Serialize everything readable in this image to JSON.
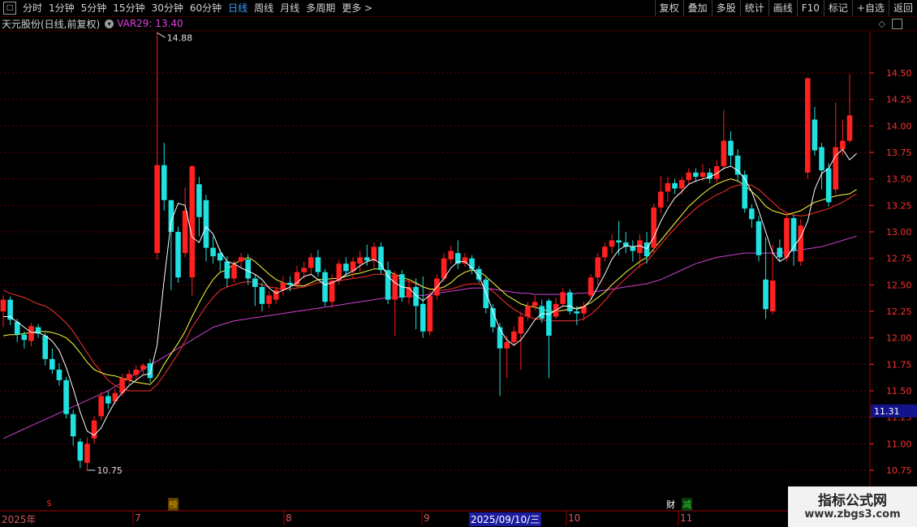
{
  "toolbar": {
    "periods": [
      "分时",
      "1分钟",
      "5分钟",
      "15分钟",
      "30分钟",
      "60分钟",
      "日线",
      "周线",
      "月线",
      "多周期",
      "更多 >"
    ],
    "active_period": "日线",
    "right_buttons": [
      "复权",
      "叠加",
      "多股",
      "统计",
      "画线",
      "F10",
      "标记",
      "+自选",
      "返回"
    ]
  },
  "title": {
    "stock": "天元股份(日线,前复权)",
    "indicator": "VAR29: 13.40"
  },
  "price_axis": {
    "ticks": [
      "14.50",
      "14.25",
      "14.00",
      "13.75",
      "13.50",
      "13.25",
      "13.00",
      "12.75",
      "12.50",
      "12.25",
      "12.00",
      "11.75",
      "11.50",
      "11.25",
      "11.00",
      "10.75"
    ],
    "current_price": "11.31"
  },
  "annotations": {
    "high": "14.88",
    "low": "10.75"
  },
  "date_axis": [
    {
      "label": "2025年",
      "selected": false
    },
    {
      "label": "7",
      "selected": false
    },
    {
      "label": "8",
      "selected": false
    },
    {
      "label": "9",
      "selected": false
    },
    {
      "label": "2025/09/10/三",
      "selected": true
    },
    {
      "label": "10",
      "selected": false
    },
    {
      "label": "11",
      "selected": false
    }
  ],
  "event_marks": [
    {
      "text": "$",
      "color": "#e02020"
    },
    {
      "text": "榜",
      "color": "#e0a000"
    },
    {
      "text": "财",
      "color": "#ffffff"
    },
    {
      "text": "减",
      "color": "#30d030"
    }
  ],
  "watermark": {
    "title": "指标公式网",
    "url": "www.zbgs3.com"
  },
  "colors": {
    "up": "#ff2020",
    "down": "#20e0e0",
    "ma_white": "#ffffff",
    "ma_yellow": "#ffff40",
    "ma_red": "#ff3030",
    "ma_magenta": "#d040d0",
    "grid": "#6a0000",
    "axis_text": "#ff3030"
  },
  "chart_data": {
    "type": "candlestick",
    "ylim": [
      10.6,
      14.95
    ],
    "candles": [
      [
        12.25,
        12.36,
        12.4,
        12.1
      ],
      [
        12.36,
        12.17,
        12.39,
        12.12
      ],
      [
        12.15,
        12.03,
        12.18,
        11.96
      ],
      [
        12.03,
        11.98,
        12.06,
        11.9
      ],
      [
        11.97,
        12.11,
        12.14,
        11.92
      ],
      [
        12.1,
        12.04,
        12.13,
        12.0
      ],
      [
        12.02,
        11.8,
        12.05,
        11.74
      ],
      [
        11.8,
        11.7,
        11.9,
        11.66
      ],
      [
        11.7,
        11.6,
        11.76,
        11.55
      ],
      [
        11.6,
        11.28,
        11.63,
        11.24
      ],
      [
        11.28,
        11.07,
        11.32,
        10.98
      ],
      [
        11.02,
        10.84,
        11.05,
        10.77
      ],
      [
        10.82,
        11.0,
        11.06,
        10.75
      ],
      [
        11.05,
        11.22,
        11.26,
        11.0
      ],
      [
        11.26,
        11.45,
        11.49,
        11.22
      ],
      [
        11.45,
        11.38,
        11.5,
        11.33
      ],
      [
        11.4,
        11.48,
        11.52,
        11.37
      ],
      [
        11.48,
        11.62,
        11.66,
        11.45
      ],
      [
        11.6,
        11.66,
        11.7,
        11.55
      ],
      [
        11.65,
        11.7,
        11.74,
        11.6
      ],
      [
        11.7,
        11.74,
        11.76,
        11.66
      ],
      [
        11.76,
        11.62,
        11.8,
        11.58
      ],
      [
        12.8,
        13.63,
        14.88,
        12.74
      ],
      [
        13.63,
        13.3,
        13.84,
        13.2
      ],
      [
        13.3,
        13.0,
        13.05,
        12.45
      ],
      [
        13.0,
        12.57,
        13.05,
        12.52
      ],
      [
        12.8,
        13.2,
        13.42,
        12.76
      ],
      [
        12.57,
        13.62,
        13.63,
        12.4
      ],
      [
        13.45,
        13.14,
        13.52,
        12.96
      ],
      [
        13.3,
        12.85,
        13.35,
        12.72
      ],
      [
        12.85,
        12.77,
        12.96,
        12.7
      ],
      [
        12.8,
        12.73,
        12.84,
        12.63
      ],
      [
        12.72,
        12.56,
        12.77,
        12.48
      ],
      [
        12.56,
        12.69,
        12.73,
        12.52
      ],
      [
        12.72,
        12.76,
        12.8,
        12.66
      ],
      [
        12.74,
        12.56,
        12.79,
        12.5
      ],
      [
        12.56,
        12.48,
        12.6,
        12.3
      ],
      [
        12.48,
        12.32,
        12.52,
        12.25
      ],
      [
        12.32,
        12.4,
        12.44,
        12.28
      ],
      [
        12.36,
        12.45,
        12.48,
        12.32
      ],
      [
        12.45,
        12.52,
        12.58,
        12.4
      ],
      [
        12.52,
        12.5,
        12.58,
        12.44
      ],
      [
        12.5,
        12.62,
        12.68,
        12.47
      ],
      [
        12.62,
        12.66,
        12.72,
        12.56
      ],
      [
        12.66,
        12.76,
        12.8,
        12.6
      ],
      [
        12.76,
        12.62,
        12.83,
        12.58
      ],
      [
        12.62,
        12.34,
        12.65,
        12.3
      ],
      [
        12.34,
        12.54,
        12.6,
        12.28
      ],
      [
        12.54,
        12.7,
        12.74,
        12.5
      ],
      [
        12.7,
        12.63,
        12.76,
        12.58
      ],
      [
        12.63,
        12.72,
        12.76,
        12.56
      ],
      [
        12.7,
        12.76,
        12.82,
        12.62
      ],
      [
        12.76,
        12.73,
        12.88,
        12.68
      ],
      [
        12.73,
        12.86,
        12.9,
        12.66
      ],
      [
        12.86,
        12.64,
        12.9,
        12.6
      ],
      [
        12.64,
        12.36,
        12.72,
        12.32
      ],
      [
        12.36,
        12.6,
        12.63,
        12.02
      ],
      [
        12.6,
        12.38,
        12.64,
        12.34
      ],
      [
        12.38,
        12.48,
        12.55,
        12.32
      ],
      [
        12.48,
        12.3,
        12.56,
        12.08
      ],
      [
        12.32,
        12.06,
        12.58,
        12.0
      ],
      [
        12.06,
        12.4,
        12.44,
        12.02
      ],
      [
        12.4,
        12.56,
        12.6,
        12.36
      ],
      [
        12.56,
        12.75,
        12.8,
        12.53
      ],
      [
        12.74,
        12.82,
        12.87,
        12.7
      ],
      [
        12.8,
        12.7,
        12.92,
        12.65
      ],
      [
        12.7,
        12.76,
        12.8,
        12.67
      ],
      [
        12.75,
        12.65,
        12.78,
        12.6
      ],
      [
        12.65,
        12.55,
        12.68,
        12.52
      ],
      [
        12.55,
        12.28,
        12.57,
        12.23
      ],
      [
        12.28,
        12.1,
        12.32,
        12.05
      ],
      [
        12.1,
        11.9,
        12.14,
        11.45
      ],
      [
        11.9,
        11.96,
        12.02,
        11.62
      ],
      [
        11.96,
        12.06,
        12.11,
        11.92
      ],
      [
        12.04,
        12.2,
        12.24,
        11.7
      ],
      [
        12.2,
        12.3,
        12.34,
        12.16
      ],
      [
        12.3,
        12.34,
        12.4,
        12.26
      ],
      [
        12.3,
        12.18,
        12.36,
        12.14
      ],
      [
        12.35,
        12.02,
        12.37,
        11.62
      ],
      [
        12.2,
        12.32,
        12.38,
        12.18
      ],
      [
        12.32,
        12.43,
        12.47,
        12.29
      ],
      [
        12.43,
        12.25,
        12.46,
        12.22
      ],
      [
        12.25,
        12.23,
        12.3,
        12.12
      ],
      [
        12.23,
        12.3,
        12.34,
        12.16
      ],
      [
        12.4,
        12.57,
        12.6,
        12.36
      ],
      [
        12.57,
        12.76,
        12.8,
        12.5
      ],
      [
        12.76,
        12.86,
        12.9,
        12.72
      ],
      [
        12.86,
        12.92,
        12.98,
        12.8
      ],
      [
        12.92,
        12.9,
        13.1,
        12.78
      ],
      [
        12.9,
        12.86,
        13.0,
        12.8
      ],
      [
        12.86,
        12.82,
        12.92,
        12.72
      ],
      [
        12.8,
        12.92,
        12.98,
        12.66
      ],
      [
        12.9,
        12.77,
        13.0,
        12.7
      ],
      [
        12.85,
        13.23,
        13.27,
        12.8
      ],
      [
        13.23,
        13.38,
        13.53,
        13.18
      ],
      [
        13.38,
        13.46,
        13.52,
        13.28
      ],
      [
        13.46,
        13.41,
        13.5,
        13.36
      ],
      [
        13.41,
        13.49,
        13.52,
        13.35
      ],
      [
        13.49,
        13.56,
        13.6,
        13.44
      ],
      [
        13.56,
        13.52,
        13.6,
        13.47
      ],
      [
        13.52,
        13.56,
        13.64,
        13.48
      ],
      [
        13.56,
        13.5,
        13.6,
        13.46
      ],
      [
        13.5,
        13.62,
        13.68,
        13.46
      ],
      [
        13.62,
        13.86,
        14.15,
        13.58
      ],
      [
        13.86,
        13.72,
        13.95,
        13.62
      ],
      [
        13.72,
        13.54,
        13.78,
        13.48
      ],
      [
        13.54,
        13.22,
        13.58,
        13.18
      ],
      [
        13.22,
        13.12,
        13.26,
        13.04
      ],
      [
        13.1,
        12.78,
        13.15,
        12.72
      ],
      [
        12.55,
        12.27,
        12.95,
        12.18
      ],
      [
        12.25,
        12.54,
        12.88,
        12.22
      ],
      [
        12.85,
        12.76,
        12.93,
        12.72
      ],
      [
        12.76,
        13.13,
        13.18,
        12.72
      ],
      [
        13.13,
        12.82,
        13.16,
        12.68
      ],
      [
        12.72,
        13.06,
        13.12,
        12.68
      ],
      [
        13.56,
        14.45,
        14.46,
        13.5
      ],
      [
        14.06,
        13.77,
        14.18,
        13.72
      ],
      [
        13.8,
        13.58,
        13.84,
        13.4
      ],
      [
        13.6,
        13.28,
        13.65,
        13.24
      ],
      [
        13.4,
        13.8,
        14.22,
        13.36
      ],
      [
        13.78,
        13.86,
        14.06,
        13.72
      ],
      [
        13.86,
        14.1,
        14.49,
        13.84
      ]
    ],
    "ma_white": [
      12.2,
      12.2,
      12.15,
      12.1,
      12.05,
      12.05,
      12.02,
      11.97,
      11.88,
      11.72,
      11.52,
      11.3,
      11.12,
      11.08,
      11.15,
      11.28,
      11.4,
      11.48,
      11.55,
      11.6,
      11.65,
      11.66,
      11.93,
      12.55,
      13.1,
      13.27,
      13.25,
      12.95,
      12.9,
      13.05,
      12.98,
      12.82,
      12.72,
      12.7,
      12.66,
      12.63,
      12.6,
      12.55,
      12.47,
      12.42,
      12.45,
      12.48,
      12.52,
      12.58,
      12.6,
      12.55,
      12.5,
      12.52,
      12.55,
      12.6,
      12.63,
      12.68,
      12.72,
      12.74,
      12.7,
      12.58,
      12.52,
      12.48,
      12.47,
      12.4,
      12.35,
      12.4,
      12.48,
      12.56,
      12.66,
      12.72,
      12.72,
      12.66,
      12.58,
      12.43,
      12.25,
      12.08,
      11.98,
      11.93,
      11.98,
      12.07,
      12.17,
      12.23,
      12.22,
      12.26,
      12.3,
      12.3,
      12.27,
      12.29,
      12.36,
      12.48,
      12.6,
      12.74,
      12.83,
      12.87,
      12.86,
      12.87,
      12.84,
      12.95,
      13.1,
      13.22,
      13.32,
      13.38,
      13.45,
      13.48,
      13.5,
      13.52,
      13.55,
      13.6,
      13.62,
      13.58,
      13.5,
      13.38,
      13.2,
      13.0,
      12.8,
      12.72,
      12.76,
      12.86,
      12.95,
      13.1,
      13.4,
      13.55,
      13.6,
      13.72,
      13.78,
      13.68,
      13.74
    ],
    "ma_yellow": [
      12.02,
      12.03,
      12.03,
      12.04,
      12.05,
      12.06,
      12.06,
      12.05,
      12.03,
      12.0,
      11.94,
      11.86,
      11.77,
      11.7,
      11.67,
      11.65,
      11.64,
      11.62,
      11.6,
      11.58,
      11.57,
      11.56,
      11.63,
      11.75,
      11.85,
      11.95,
      12.06,
      12.2,
      12.33,
      12.45,
      12.55,
      12.62,
      12.64,
      12.7,
      12.73,
      12.76,
      12.72,
      12.66,
      12.6,
      12.55,
      12.52,
      12.5,
      12.49,
      12.49,
      12.52,
      12.55,
      12.55,
      12.56,
      12.56,
      12.58,
      12.6,
      12.61,
      12.63,
      12.65,
      12.65,
      12.63,
      12.6,
      12.57,
      12.55,
      12.52,
      12.48,
      12.46,
      12.46,
      12.48,
      12.52,
      12.58,
      12.62,
      12.64,
      12.63,
      12.58,
      12.52,
      12.46,
      12.4,
      12.36,
      12.32,
      12.3,
      12.29,
      12.27,
      12.25,
      12.25,
      12.26,
      12.27,
      12.28,
      12.3,
      12.33,
      12.38,
      12.43,
      12.5,
      12.56,
      12.62,
      12.67,
      12.72,
      12.76,
      12.84,
      12.92,
      13.0,
      13.08,
      13.16,
      13.24,
      13.3,
      13.36,
      13.41,
      13.45,
      13.48,
      13.5,
      13.48,
      13.44,
      13.38,
      13.32,
      13.24,
      13.2,
      13.18,
      13.16,
      13.18,
      13.2,
      13.24,
      13.28,
      13.3,
      13.32,
      13.34,
      13.35,
      13.36,
      13.4
    ],
    "ma_red": [
      12.45,
      12.42,
      12.4,
      12.38,
      12.35,
      12.32,
      12.3,
      12.26,
      12.2,
      12.14,
      12.06,
      11.96,
      11.86,
      11.76,
      11.68,
      11.6,
      11.55,
      11.52,
      11.5,
      11.5,
      11.5,
      11.5,
      11.56,
      11.65,
      11.75,
      11.85,
      11.97,
      12.1,
      12.2,
      12.3,
      12.38,
      12.45,
      12.48,
      12.5,
      12.52,
      12.53,
      12.52,
      12.5,
      12.48,
      12.47,
      12.46,
      12.46,
      12.47,
      12.48,
      12.5,
      12.52,
      12.52,
      12.53,
      12.54,
      12.55,
      12.56,
      12.57,
      12.58,
      12.6,
      12.6,
      12.59,
      12.57,
      12.55,
      12.53,
      12.51,
      12.48,
      12.46,
      12.45,
      12.45,
      12.46,
      12.48,
      12.5,
      12.51,
      12.51,
      12.48,
      12.44,
      12.38,
      12.32,
      12.27,
      12.23,
      12.2,
      12.18,
      12.17,
      12.16,
      12.16,
      12.16,
      12.16,
      12.16,
      12.18,
      12.22,
      12.28,
      12.35,
      12.43,
      12.5,
      12.56,
      12.62,
      12.68,
      12.72,
      12.8,
      12.88,
      12.96,
      13.03,
      13.1,
      13.16,
      13.22,
      13.27,
      13.31,
      13.35,
      13.38,
      13.42,
      13.44,
      13.45,
      13.44,
      13.4,
      13.34,
      13.28,
      13.22,
      13.18,
      13.16,
      13.15,
      13.16,
      13.18,
      13.2,
      13.22,
      13.25,
      13.28,
      13.32,
      13.36
    ],
    "ma_magenta": [
      11.05,
      11.08,
      11.11,
      11.14,
      11.17,
      11.2,
      11.23,
      11.26,
      11.29,
      11.32,
      11.35,
      11.38,
      11.41,
      11.44,
      11.47,
      11.5,
      11.54,
      11.58,
      11.62,
      11.66,
      11.7,
      11.74,
      11.78,
      11.82,
      11.86,
      11.9,
      11.94,
      11.98,
      12.02,
      12.06,
      12.1,
      12.12,
      12.14,
      12.16,
      12.17,
      12.18,
      12.19,
      12.2,
      12.21,
      12.22,
      12.23,
      12.24,
      12.25,
      12.26,
      12.27,
      12.28,
      12.29,
      12.3,
      12.31,
      12.32,
      12.33,
      12.34,
      12.35,
      12.36,
      12.37,
      12.38,
      12.38,
      12.39,
      12.39,
      12.4,
      12.4,
      12.41,
      12.42,
      12.43,
      12.44,
      12.45,
      12.46,
      12.47,
      12.47,
      12.47,
      12.46,
      12.45,
      12.44,
      12.43,
      12.42,
      12.42,
      12.41,
      12.41,
      12.41,
      12.41,
      12.41,
      12.41,
      12.42,
      12.42,
      12.43,
      12.44,
      12.45,
      12.46,
      12.47,
      12.48,
      12.49,
      12.5,
      12.51,
      12.53,
      12.55,
      12.58,
      12.61,
      12.64,
      12.67,
      12.7,
      12.72,
      12.74,
      12.76,
      12.77,
      12.78,
      12.79,
      12.8,
      12.8,
      12.8,
      12.8,
      12.8,
      12.8,
      12.81,
      12.82,
      12.83,
      12.84,
      12.85,
      12.86,
      12.88,
      12.9,
      12.92,
      12.94,
      12.96
    ]
  }
}
